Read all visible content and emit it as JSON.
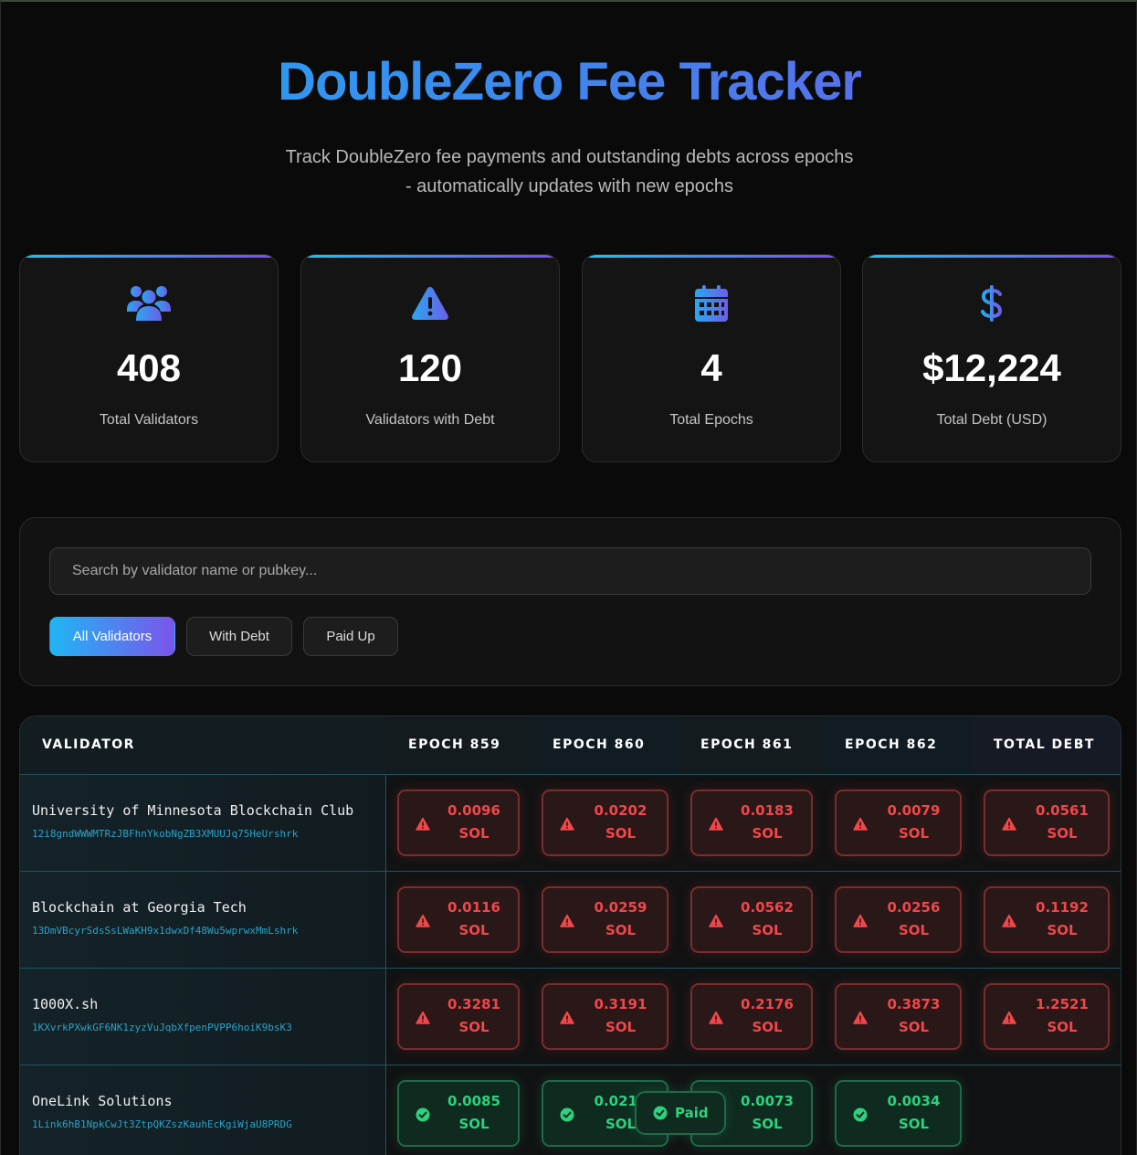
{
  "header": {
    "title": "DoubleZero Fee Tracker",
    "subtitle": "Track DoubleZero fee payments and outstanding debts across epochs - automatically updates with new epochs"
  },
  "stats": [
    {
      "icon": "users-icon",
      "value": "408",
      "label": "Total Validators"
    },
    {
      "icon": "warning-icon",
      "value": "120",
      "label": "Validators with Debt"
    },
    {
      "icon": "calendar-icon",
      "value": "4",
      "label": "Total Epochs"
    },
    {
      "icon": "dollar-icon",
      "value": "$12,224",
      "label": "Total Debt (USD)"
    }
  ],
  "search": {
    "placeholder": "Search by validator name or pubkey..."
  },
  "filters": [
    {
      "label": "All Validators",
      "active": true
    },
    {
      "label": "With Debt",
      "active": false
    },
    {
      "label": "Paid Up",
      "active": false
    }
  ],
  "table": {
    "headers": [
      "VALIDATOR",
      "EPOCH 859",
      "EPOCH 860",
      "EPOCH 861",
      "EPOCH 862",
      "TOTAL DEBT"
    ],
    "rows": [
      {
        "name": "University of Minnesota Blockchain Club",
        "pubkey": "12i8gndWWWMTRzJBFhnYkobNgZB3XMUUJq75HeUrshrk",
        "epochs": [
          {
            "status": "debt",
            "amount": "0.0096",
            "unit": "SOL"
          },
          {
            "status": "debt",
            "amount": "0.0202",
            "unit": "SOL"
          },
          {
            "status": "debt",
            "amount": "0.0183",
            "unit": "SOL"
          },
          {
            "status": "debt",
            "amount": "0.0079",
            "unit": "SOL"
          }
        ],
        "total": {
          "status": "debt",
          "amount": "0.0561",
          "unit": "SOL"
        }
      },
      {
        "name": "Blockchain at Georgia Tech",
        "pubkey": "13DmVBcyrSdsSsLWaKH9x1dwxDf48Wu5wprwxMmLshrk",
        "epochs": [
          {
            "status": "debt",
            "amount": "0.0116",
            "unit": "SOL"
          },
          {
            "status": "debt",
            "amount": "0.0259",
            "unit": "SOL"
          },
          {
            "status": "debt",
            "amount": "0.0562",
            "unit": "SOL"
          },
          {
            "status": "debt",
            "amount": "0.0256",
            "unit": "SOL"
          }
        ],
        "total": {
          "status": "debt",
          "amount": "0.1192",
          "unit": "SOL"
        }
      },
      {
        "name": "1000X.sh",
        "pubkey": "1KXvrkPXwkGF6NK1zyzVuJqbXfpenPVPP6hoiK9bsK3",
        "epochs": [
          {
            "status": "debt",
            "amount": "0.3281",
            "unit": "SOL"
          },
          {
            "status": "debt",
            "amount": "0.3191",
            "unit": "SOL"
          },
          {
            "status": "debt",
            "amount": "0.2176",
            "unit": "SOL"
          },
          {
            "status": "debt",
            "amount": "0.3873",
            "unit": "SOL"
          }
        ],
        "total": {
          "status": "debt",
          "amount": "1.2521",
          "unit": "SOL"
        }
      },
      {
        "name": "OneLink Solutions",
        "pubkey": "1Link6hB1NpkCwJt3ZtpQKZszKauhEcKgiWjaU8PRDG",
        "epochs": [
          {
            "status": "paid",
            "amount": "0.0085",
            "unit": "SOL"
          },
          {
            "status": "paid",
            "amount": "0.0214",
            "unit": "SOL"
          },
          {
            "status": "paid",
            "amount": "0.0073",
            "unit": "SOL"
          },
          {
            "status": "paid",
            "amount": "0.0034",
            "unit": "SOL"
          }
        ],
        "total": {
          "status": "paid",
          "label": "Paid"
        }
      }
    ]
  },
  "colors": {
    "accent_start": "#22a8f0",
    "accent_end": "#6c5ee8",
    "debt": "#f0474a",
    "paid": "#2fd17f"
  }
}
